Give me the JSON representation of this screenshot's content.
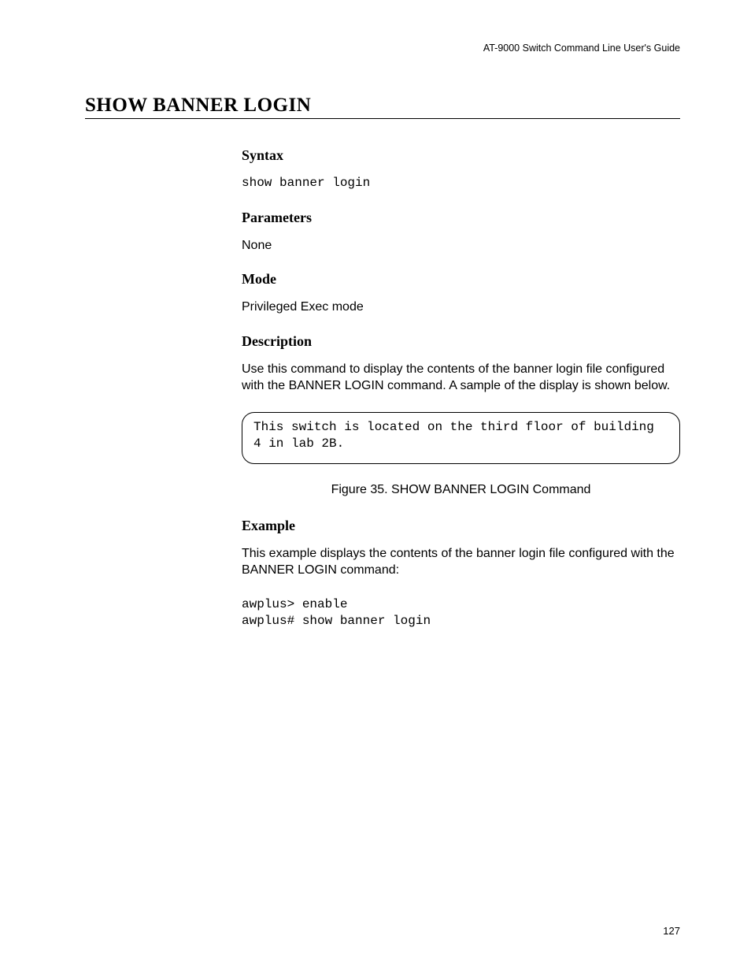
{
  "header": {
    "running_title": "AT-9000 Switch Command Line User's Guide"
  },
  "section": {
    "title": "SHOW BANNER LOGIN"
  },
  "syntax": {
    "heading": "Syntax",
    "code": "show banner login"
  },
  "parameters": {
    "heading": "Parameters",
    "text": "None"
  },
  "mode": {
    "heading": "Mode",
    "text": "Privileged Exec mode"
  },
  "description": {
    "heading": "Description",
    "text": "Use this command to display the contents of the banner login file configured with the BANNER LOGIN command. A sample of the display is shown below."
  },
  "output_box": {
    "text": "This switch is located on the third floor of building 4 in lab 2B."
  },
  "figure": {
    "caption": "Figure 35. SHOW BANNER LOGIN Command"
  },
  "example": {
    "heading": "Example",
    "text": "This example displays the contents of the banner login file configured with the BANNER LOGIN command:",
    "code": "awplus> enable\nawplus# show banner login"
  },
  "page_number": "127"
}
